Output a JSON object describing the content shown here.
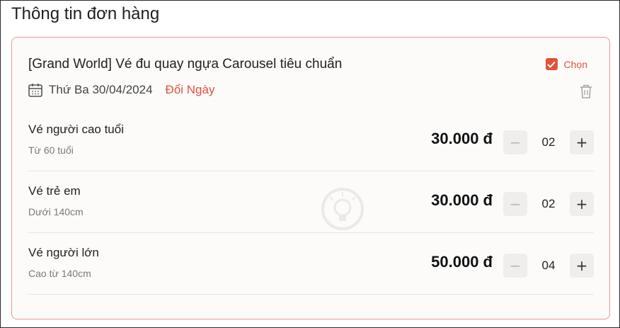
{
  "page": {
    "title": "Thông tin đơn hàng"
  },
  "order": {
    "product_title": "[Grand World] Vé đu quay ngựa Carousel tiêu chuẩn",
    "select_label": "Chọn",
    "date": "Thứ Ba 30/04/2024",
    "change_date_label": "Đổi Ngày",
    "icons": {
      "calendar": "calendar-icon",
      "trash": "trash-icon",
      "checkbox": "checkmark-icon"
    },
    "tickets": [
      {
        "name": "Vé người cao tuổi",
        "desc": "Từ 60 tuổi",
        "price": "30.000 đ",
        "qty": "02"
      },
      {
        "name": "Vé trẻ em",
        "desc": "Dưới 140cm",
        "price": "30.000 đ",
        "qty": "02"
      },
      {
        "name": "Vé người lớn",
        "desc": "Cao từ 140cm",
        "price": "50.000 đ",
        "qty": "04"
      }
    ],
    "stepper": {
      "minus": "−",
      "plus": "+"
    }
  },
  "colors": {
    "accent": "#e0533a",
    "card_border": "#e8998a"
  }
}
